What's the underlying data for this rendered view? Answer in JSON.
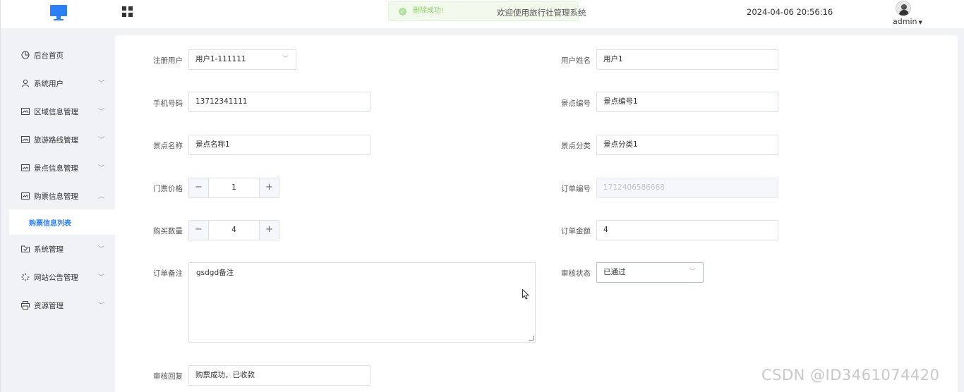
{
  "header": {
    "logo_icon": "monitor-icon",
    "apps_icon": "grid-icon",
    "toast": "删除成功!",
    "welcome": "欢迎使用旅行社管理系统",
    "datetime": "2024-04-06 20:56:16",
    "user": "admin"
  },
  "sidebar": {
    "items": [
      {
        "label": "后台首页",
        "icon": "clock-icon"
      },
      {
        "label": "系统用户",
        "icon": "user-icon"
      },
      {
        "label": "区域信息管理",
        "icon": "picture-icon"
      },
      {
        "label": "旅游路线管理",
        "icon": "picture-icon"
      },
      {
        "label": "景点信息管理",
        "icon": "picture-icon"
      },
      {
        "label": "购票信息管理",
        "icon": "picture-icon"
      },
      {
        "label": "系统管理",
        "icon": "folder-icon"
      },
      {
        "label": "网站公告管理",
        "icon": "loading-icon"
      },
      {
        "label": "资源管理",
        "icon": "printer-icon"
      }
    ],
    "active_sub": "购票信息列表"
  },
  "form": {
    "reg_user_label": "注册用户",
    "reg_user_value": "用户1-111111",
    "user_name_label": "用户姓名",
    "user_name_value": "用户1",
    "phone_label": "手机号码",
    "phone_value": "13712341111",
    "spot_no_label": "景点编号",
    "spot_no_value": "景点编号1",
    "spot_name_label": "景点名称",
    "spot_name_value": "景点名称1",
    "spot_cat_label": "景点分类",
    "spot_cat_value": "景点分类1",
    "price_label": "门票价格",
    "price_value": "1",
    "order_no_label": "订单编号",
    "order_no_value": "1712406586668",
    "qty_label": "购买数量",
    "qty_value": "4",
    "amount_label": "订单金额",
    "amount_value": "4",
    "remark_label": "订单备注",
    "remark_value": "gsdgd备注",
    "audit_label": "审核状态",
    "audit_value": "已通过",
    "reply_label": "审核回复",
    "reply_value": "购票成功，已收款"
  },
  "watermark": "CSDN @ID3461074420"
}
